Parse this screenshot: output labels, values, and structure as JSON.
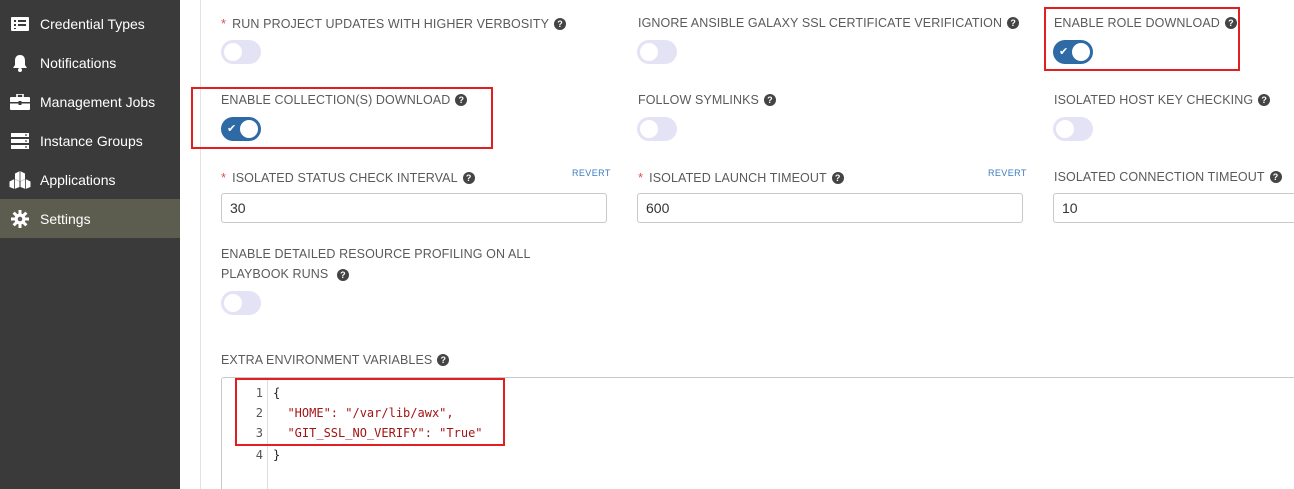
{
  "sidebar": {
    "items": [
      {
        "label": "Credential Types",
        "icon": "credential-types-icon"
      },
      {
        "label": "Notifications",
        "icon": "bell-icon"
      },
      {
        "label": "Management Jobs",
        "icon": "briefcase-icon"
      },
      {
        "label": "Instance Groups",
        "icon": "server-icon"
      },
      {
        "label": "Applications",
        "icon": "cubes-icon"
      },
      {
        "label": "Settings",
        "icon": "gear-icon",
        "active": true
      }
    ]
  },
  "settings": {
    "run_project_updates": {
      "label": "RUN PROJECT UPDATES WITH HIGHER VERBOSITY",
      "required": "*",
      "enabled": false
    },
    "ignore_galaxy_ssl": {
      "label": "IGNORE ANSIBLE GALAXY SSL CERTIFICATE VERIFICATION",
      "enabled": false
    },
    "enable_role_download": {
      "label": "ENABLE ROLE DOWNLOAD",
      "enabled": true
    },
    "enable_collections_download": {
      "label": "ENABLE COLLECTION(S) DOWNLOAD",
      "enabled": true
    },
    "follow_symlinks": {
      "label": "FOLLOW SYMLINKS",
      "enabled": false
    },
    "isolated_host_key_checking": {
      "label": "ISOLATED HOST KEY CHECKING",
      "enabled": false
    },
    "isolated_status_check_interval": {
      "label": "ISOLATED STATUS CHECK INTERVAL",
      "required": "*",
      "value": "30",
      "revert": "REVERT"
    },
    "isolated_launch_timeout": {
      "label": "ISOLATED LAUNCH TIMEOUT",
      "required": "*",
      "value": "600",
      "revert": "REVERT"
    },
    "isolated_connection_timeout": {
      "label": "ISOLATED CONNECTION TIMEOUT",
      "value": "10"
    },
    "detailed_profiling": {
      "label": "ENABLE DETAILED RESOURCE PROFILING ON ALL PLAYBOOK RUNS",
      "enabled": false
    },
    "extra_env_vars": {
      "label": "EXTRA ENVIRONMENT VARIABLES",
      "line_numbers": [
        "1",
        "2",
        "3",
        "4"
      ],
      "lines": [
        "{",
        "  \"HOME\": \"/var/lib/awx\",",
        "  \"GIT_SSL_NO_VERIFY\": \"True\"",
        "}"
      ]
    }
  },
  "help_glyph": "?",
  "check_glyph": "✔",
  "colors": {
    "toggle_on": "#2d6aa6",
    "toggle_off": "#e4e2f5",
    "sidebar_bg": "#3a3a3a",
    "sidebar_active": "#5d5d4f",
    "annotation": "#e02020"
  }
}
